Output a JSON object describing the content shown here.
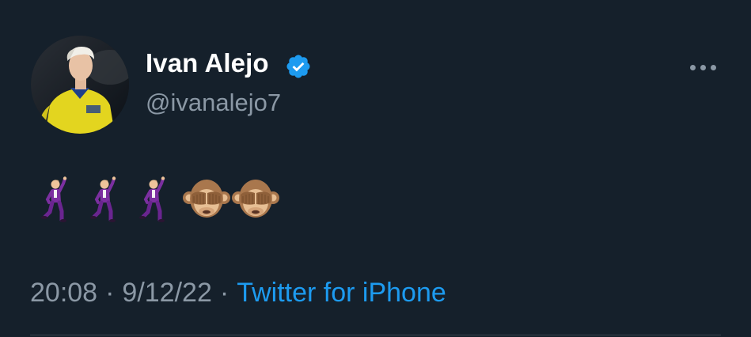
{
  "author": {
    "display_name": "Ivan Alejo",
    "handle": "@ivanalejo7",
    "verified": true,
    "avatar_icon": "avatar-photo"
  },
  "tweet": {
    "emojis": [
      {
        "name": "man-dancing-emoji",
        "char": "🕺"
      },
      {
        "name": "man-dancing-emoji",
        "char": "🕺"
      },
      {
        "name": "man-dancing-emoji",
        "char": "🕺"
      },
      {
        "name": "see-no-evil-monkey-emoji",
        "char": "🙈"
      },
      {
        "name": "see-no-evil-monkey-emoji",
        "char": "🙈"
      }
    ]
  },
  "meta": {
    "time": "20:08",
    "separator": "·",
    "date": "9/12/22",
    "source": "Twitter for iPhone"
  },
  "colors": {
    "background": "#15202b",
    "secondary_text": "#8b98a5",
    "accent": "#1d9bf0"
  },
  "icons": {
    "more": "more-dots-icon",
    "verified": "verified-badge-icon"
  }
}
